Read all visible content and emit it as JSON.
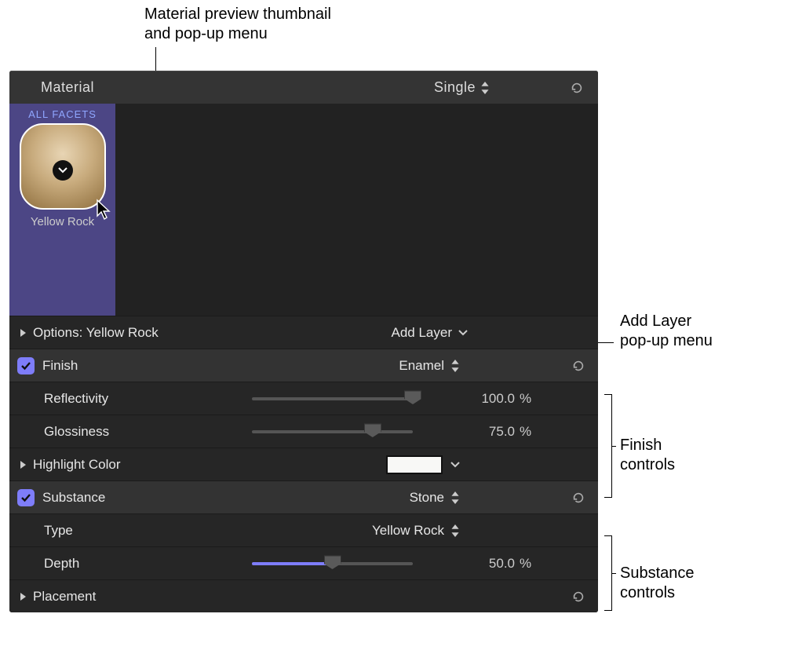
{
  "callouts": {
    "top": "Material preview thumbnail\nand pop-up menu",
    "addlayer": "Add Layer\npop-up menu",
    "finish": "Finish\ncontrols",
    "substance": "Substance\ncontrols"
  },
  "titlebar": {
    "material_label": "Material",
    "mode": "Single"
  },
  "preview": {
    "facets": "ALL FACETS",
    "name": "Yellow Rock"
  },
  "options": {
    "label_prefix": "Options: ",
    "name": "Yellow Rock",
    "add_layer": "Add Layer"
  },
  "finish": {
    "label": "Finish",
    "type": "Enamel",
    "reflectivity": {
      "label": "Reflectivity",
      "value": "100.0",
      "unit": "%"
    },
    "glossiness": {
      "label": "Glossiness",
      "value": "75.0",
      "unit": "%"
    },
    "highlight": {
      "label": "Highlight Color",
      "swatch": "#f8f8f6"
    }
  },
  "substance": {
    "label": "Substance",
    "kind": "Stone",
    "type": {
      "label": "Type",
      "value": "Yellow Rock"
    },
    "depth": {
      "label": "Depth",
      "value": "50.0",
      "unit": "%"
    }
  },
  "placement": {
    "label": "Placement"
  }
}
